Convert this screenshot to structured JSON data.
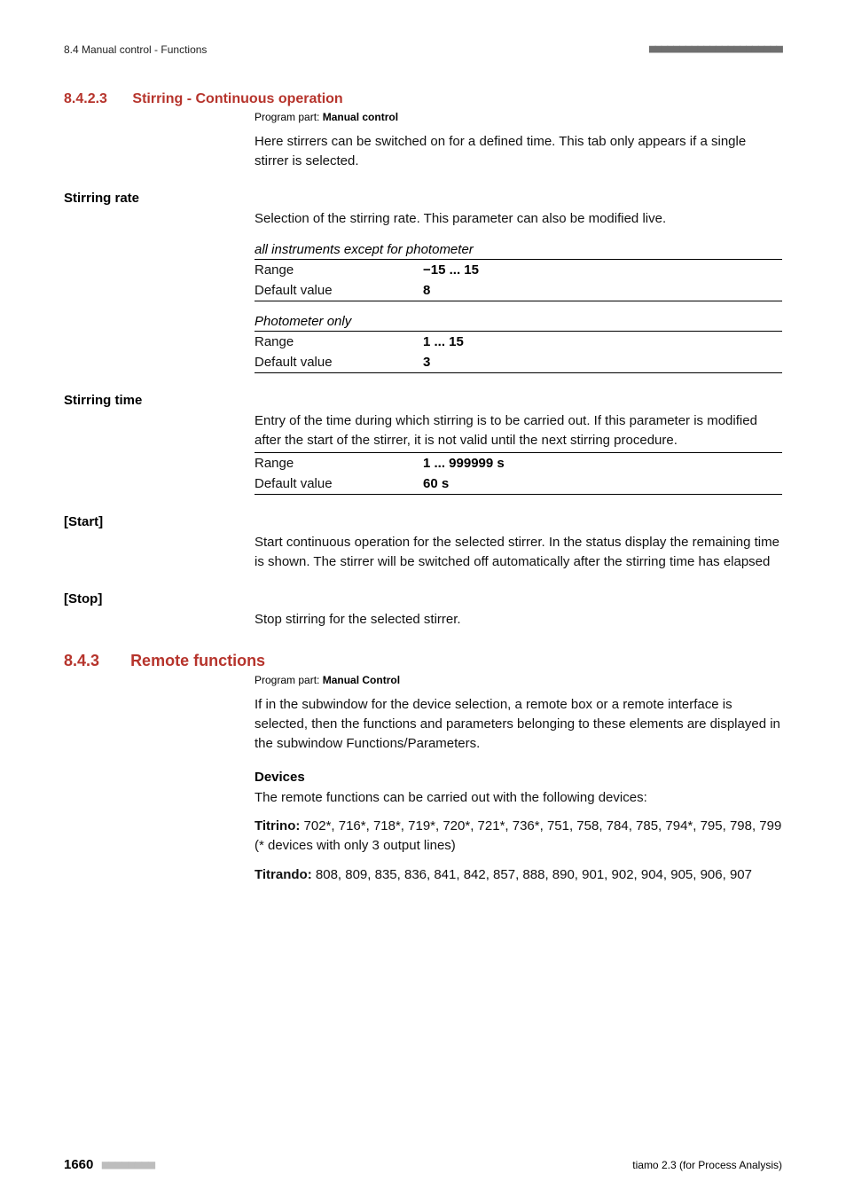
{
  "header": {
    "left": "8.4 Manual control - Functions",
    "barcode": "■■■■■■■■■■■■■■■■■■■■■■"
  },
  "s1": {
    "num": "8.4.2.3",
    "title": "Stirring - Continuous operation",
    "program_part_label": "Program part: ",
    "program_part_value": "Manual control",
    "intro": "Here stirrers can be switched on for a defined time. This tab only appears if a single stirrer is selected."
  },
  "stirring_rate": {
    "label": "Stirring rate",
    "desc": "Selection of the stirring rate. This parameter can also be modified live.",
    "block1": {
      "caption": "all instruments except for photometer",
      "range_key": "Range",
      "range_val": "−15 ... 15",
      "default_key": "Default value",
      "default_val": "8"
    },
    "block2": {
      "caption": "Photometer only",
      "range_key": "Range",
      "range_val": "1 ... 15",
      "default_key": "Default value",
      "default_val": "3"
    }
  },
  "stirring_time": {
    "label": "Stirring time",
    "desc": "Entry of the time during which stirring is to be carried out. If this parameter is modified after the start of the stirrer, it is not valid until the next stirring procedure.",
    "range_key": "Range",
    "range_val": "1 ... 999999 s",
    "default_key": "Default value",
    "default_val": "60 s"
  },
  "start": {
    "label": "[Start]",
    "desc": "Start continuous operation for the selected stirrer. In the status display the remaining time is shown. The stirrer will be switched off automatically after the stirring time has elapsed"
  },
  "stop": {
    "label": "[Stop]",
    "desc": "Stop stirring for the selected stirrer."
  },
  "s2": {
    "num": "8.4.3",
    "title": "Remote functions",
    "program_part_label": "Program part: ",
    "program_part_value": "Manual Control",
    "intro": "If in the subwindow for the device selection, a remote box or a remote interface is selected, then the functions and parameters belonging to these elements are displayed in the subwindow Functions/Parameters.",
    "devices_h": "Devices",
    "devices_intro": "The remote functions can be carried out with the following devices:",
    "titrino_label": "Titrino: ",
    "titrino_body": "702*, 716*, 718*, 719*, 720*, 721*, 736*, 751, 758, 784, 785, 794*, 795, 798, 799 (* devices with only 3 output lines)",
    "titrando_label": "Titrando: ",
    "titrando_body": "808, 809, 835, 836, 841, 842, 857, 888, 890, 901, 902, 904, 905, 906, 907"
  },
  "footer": {
    "page": "1660",
    "bars": "■■■■■■■■",
    "product": "tiamo 2.3 (for Process Analysis)"
  }
}
